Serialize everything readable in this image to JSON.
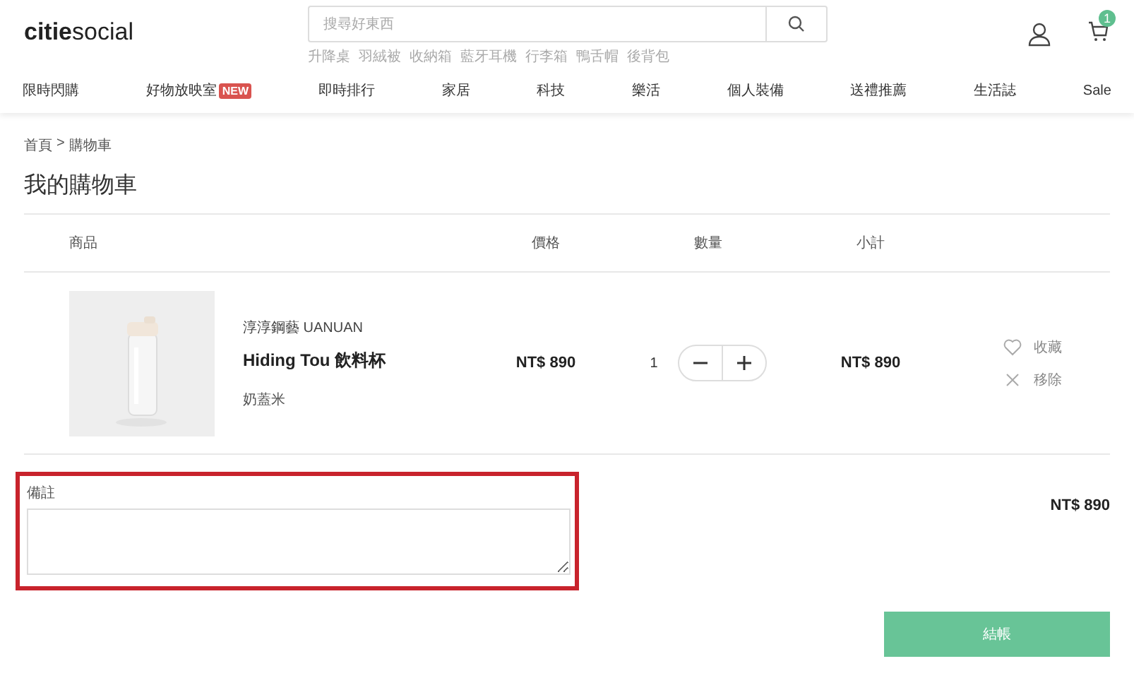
{
  "header": {
    "logo_bold": "citie",
    "logo_light": "social",
    "search": {
      "placeholder": "搜尋好東西"
    },
    "suggestions": [
      "升降桌",
      "羽絨被",
      "收納箱",
      "藍牙耳機",
      "行李箱",
      "鴨舌帽",
      "後背包"
    ],
    "cart_count": "1"
  },
  "nav": [
    {
      "label": "限時閃購"
    },
    {
      "label": "好物放映室",
      "badge": "NEW"
    },
    {
      "label": "即時排行"
    },
    {
      "label": "家居"
    },
    {
      "label": "科技"
    },
    {
      "label": "樂活"
    },
    {
      "label": "個人裝備"
    },
    {
      "label": "送禮推薦"
    },
    {
      "label": "生活誌"
    },
    {
      "label": "Sale"
    }
  ],
  "breadcrumb": [
    "首頁",
    "購物車"
  ],
  "breadcrumb_separator": ">",
  "title": "我的購物車",
  "table": {
    "columns": [
      "商品",
      "價格",
      "數量",
      "小計"
    ],
    "rows": [
      {
        "brand": "淳淳鋼藝 UANUAN",
        "name": "Hiding Tou 飲料杯",
        "variant": "奶蓋米",
        "price": "NT$ 890",
        "quantity": "1",
        "subtotal": "NT$ 890",
        "actions": [
          {
            "kind": "favorite",
            "label": "收藏"
          },
          {
            "kind": "remove",
            "label": "移除"
          }
        ]
      }
    ]
  },
  "notes": {
    "label": "備註",
    "highlighted": true
  },
  "total": "NT$ 890",
  "checkout_button": "結帳"
}
